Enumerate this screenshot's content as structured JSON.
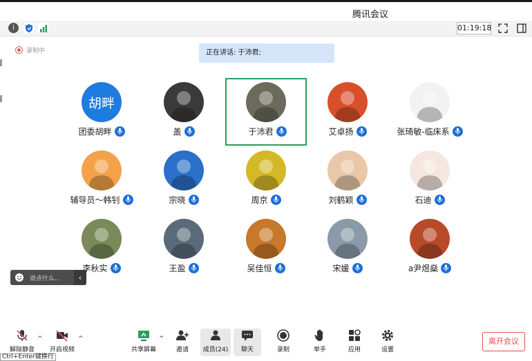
{
  "window": {
    "title": "腾讯会议"
  },
  "infobar": {
    "timer": "01:19:18"
  },
  "recording": {
    "label": "录制中"
  },
  "speaking": {
    "text": "正在讲话: 于沛君;"
  },
  "participants": [
    {
      "name": "团委胡畔",
      "avatar_text": "胡畔",
      "avatar_color": "#1e7be0"
    },
    {
      "name": "盖",
      "avatar_color": "#3a3a3a"
    },
    {
      "name": "于沛君",
      "avatar_color": "#6b6a5c",
      "active": true
    },
    {
      "name": "艾卓扬",
      "avatar_color": "#d8502a"
    },
    {
      "name": "张琦敏-临床系",
      "avatar_color": "#f2f2f2"
    },
    {
      "name": "辅导员～韩钊",
      "avatar_color": "#f3a24a"
    },
    {
      "name": "宗晓",
      "avatar_color": "#2a6fc8"
    },
    {
      "name": "周京",
      "avatar_color": "#d4b828"
    },
    {
      "name": "刘鹤颖",
      "avatar_color": "#e8c8a8"
    },
    {
      "name": "石迪",
      "avatar_color": "#f6e6e0"
    },
    {
      "name": "李秋实",
      "avatar_color": "#7a8a5a"
    },
    {
      "name": "王盈",
      "avatar_color": "#5a6a7a"
    },
    {
      "name": "吴佳恒",
      "avatar_color": "#c8782a"
    },
    {
      "name": "宋媛",
      "avatar_color": "#8a9aa8"
    },
    {
      "name": "a尹煜燊",
      "avatar_color": "#b84a2a"
    }
  ],
  "chat": {
    "placeholder": "说点什么..."
  },
  "toolbar": {
    "unmute": "解除静音",
    "start_video": "开启视频",
    "share": "共享屏幕",
    "invite": "邀请",
    "members": "成员(24)",
    "chat": "聊天",
    "record": "录制",
    "raise_hand": "举手",
    "apps": "应用",
    "settings": "设置",
    "leave": "离开会议"
  },
  "tooltip": {
    "text": "Ctrl+Enter键换行"
  },
  "colors": {
    "accent_blue": "#1d6fd8",
    "active_border": "#2a9d5c",
    "leave_red": "#e05050"
  }
}
